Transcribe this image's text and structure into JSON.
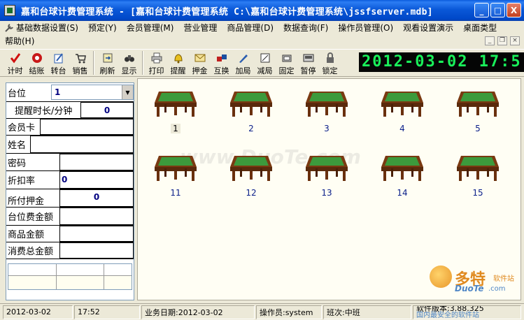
{
  "window": {
    "title": "嘉和台球计费管理系统 - [嘉和台球计费管理系统   C:\\嘉和台球计费管理系统\\jssfserver.mdb]",
    "min_label": "_",
    "max_label": "□",
    "close_label": "X"
  },
  "menu": {
    "items": [
      {
        "label": "基础数据设置(S)"
      },
      {
        "label": "预定(Y)"
      },
      {
        "label": "会员管理(M)"
      },
      {
        "label": "营业管理"
      },
      {
        "label": "商品管理(D)"
      },
      {
        "label": "数据查询(F)"
      },
      {
        "label": "操作员管理(O)"
      },
      {
        "label": "观看设置演示"
      },
      {
        "label": "桌面类型"
      }
    ],
    "help_label": "帮助(H)",
    "mdi_min": "_",
    "mdi_restore": "❐",
    "mdi_close": "×"
  },
  "toolbar": {
    "buttons": [
      {
        "label": "计时",
        "icon": "checkmark-icon"
      },
      {
        "label": "结账",
        "icon": "stop-icon"
      },
      {
        "label": "转台",
        "icon": "edit-icon"
      },
      {
        "label": "销售",
        "icon": "cart-icon"
      },
      {
        "label": "刷新",
        "icon": "refresh-icon"
      },
      {
        "label": "显示",
        "icon": "binoculars-icon"
      },
      {
        "label": "打印",
        "icon": "printer-icon"
      },
      {
        "label": "提醒",
        "icon": "bell-icon"
      },
      {
        "label": "押金",
        "icon": "envelope-icon"
      },
      {
        "label": "互换",
        "icon": "swap-icon"
      },
      {
        "label": "加局",
        "icon": "pencil-icon"
      },
      {
        "label": "减局",
        "icon": "frame-icon"
      },
      {
        "label": "固定",
        "icon": "lock-icon"
      },
      {
        "label": "暂停",
        "icon": "pause-icon"
      },
      {
        "label": "锁定",
        "icon": "padlock-icon"
      }
    ],
    "clock_text": "2012-03-02  17:5"
  },
  "left_panel": {
    "table_label": "台位",
    "table_value": "1",
    "remind_label": "提醒时长/分钟",
    "remind_value": "0",
    "member_card_label": "会员卡",
    "member_card_value": "",
    "name_label": "姓名",
    "name_value": "",
    "password_label": "密码",
    "discount_label": "折扣率",
    "discount_value": "0",
    "deposit_label": "所付押金",
    "deposit_value": "0",
    "table_fee_label": "台位费金额",
    "goods_label": "商品金额",
    "total_label": "消费总金额"
  },
  "tables": [
    {
      "num": "1"
    },
    {
      "num": "2"
    },
    {
      "num": "3"
    },
    {
      "num": "4"
    },
    {
      "num": "5"
    },
    {
      "num": "11"
    },
    {
      "num": "12"
    },
    {
      "num": "13"
    },
    {
      "num": "14"
    },
    {
      "num": "15"
    }
  ],
  "watermark": {
    "site": "www.DuoTe.com",
    "brand_big": "多特",
    "brand_small": "软件站",
    "brand_en": "DuoTe",
    "brand_en_sub": ".com"
  },
  "status": {
    "date": "2012-03-02",
    "time": "17:52",
    "business_date": "业务日期:2012-03-02",
    "operator": "操作员:system",
    "shift": "班次:中班",
    "version": "软件版本:3.88.325",
    "notice": "国内最安全的软件站"
  },
  "colors": {
    "clock_bg": "#050505",
    "clock_fg": "#19f05a",
    "table_label": "#0b1f8a",
    "field_value": "#000080"
  }
}
